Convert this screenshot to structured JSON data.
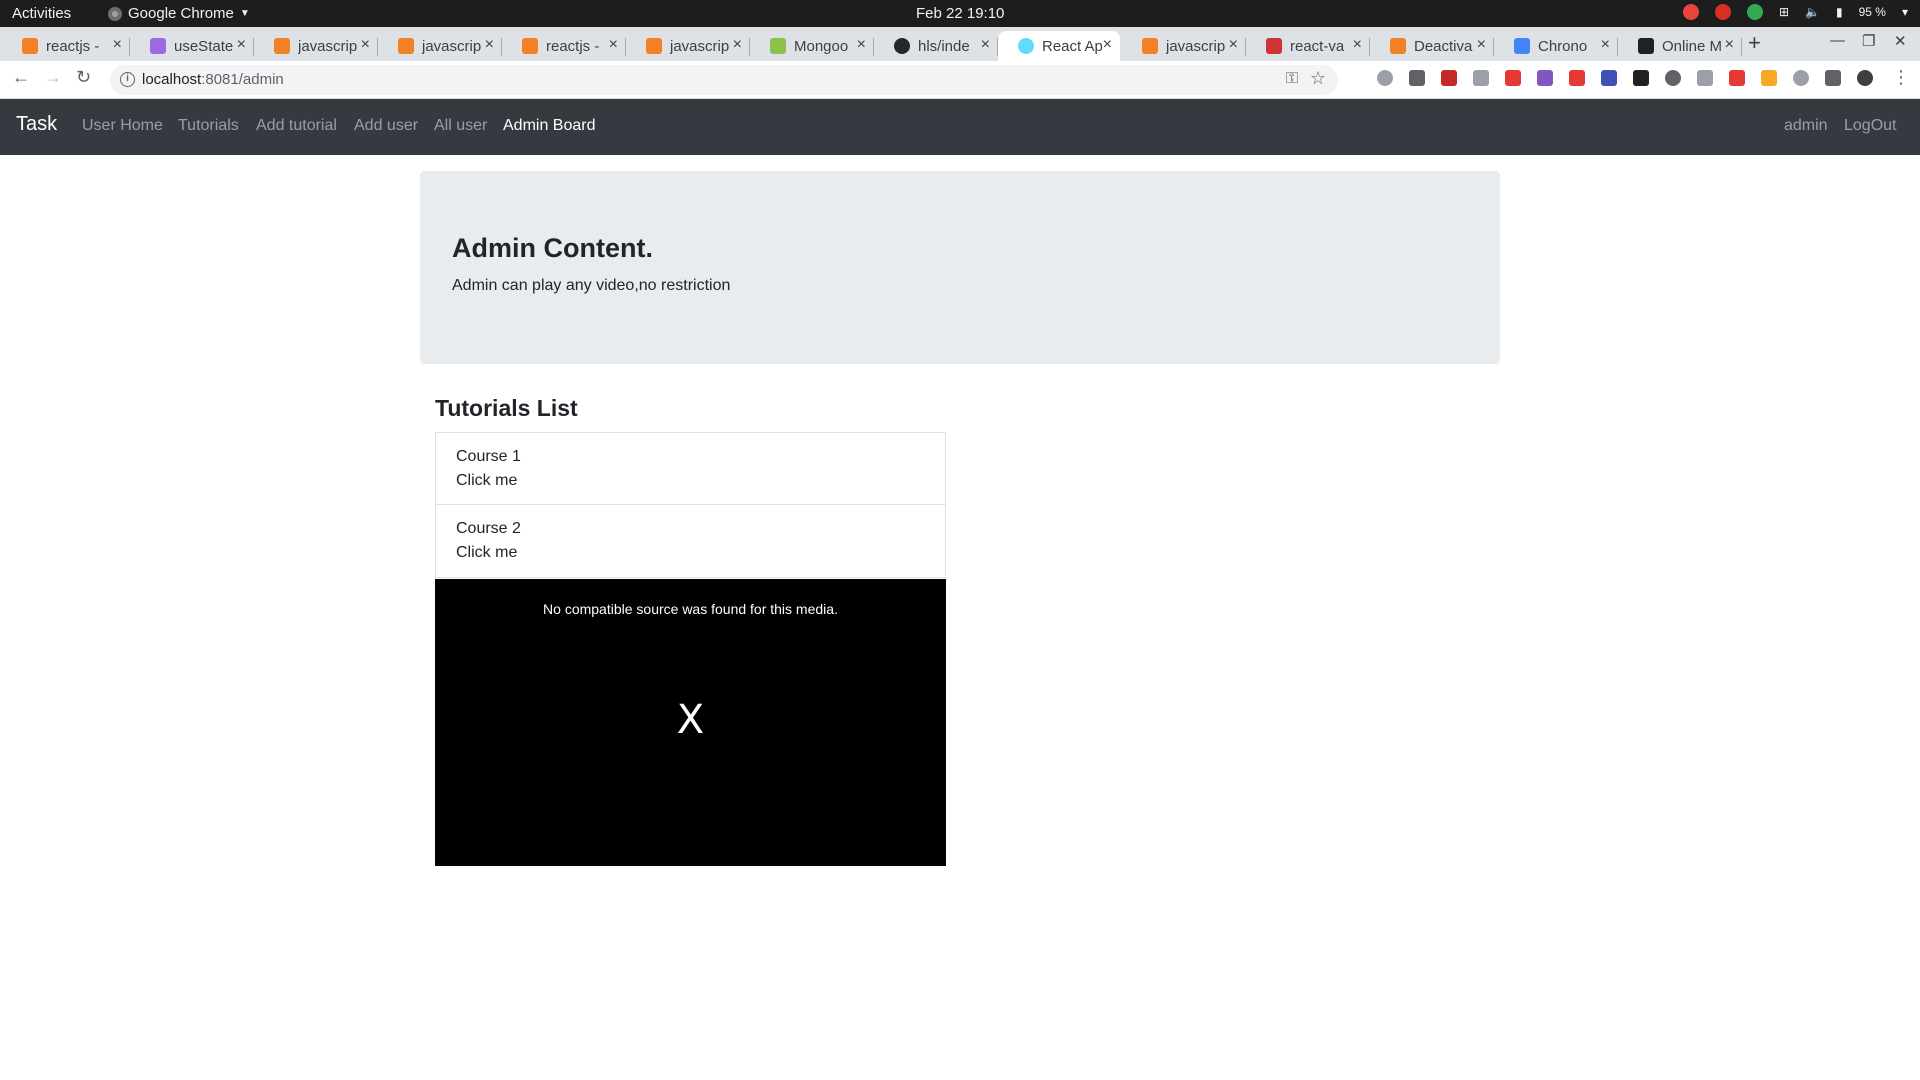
{
  "os": {
    "activities": "Activities",
    "app_name": "Google Chrome",
    "clock": "Feb 22  19:10",
    "battery": "95 %"
  },
  "tabs": [
    {
      "title": "reactjs - ",
      "favicon_color": "#f48024"
    },
    {
      "title": "useState",
      "favicon_color": "#9c6ade"
    },
    {
      "title": "javascrip",
      "favicon_color": "#f48024"
    },
    {
      "title": "javascrip",
      "favicon_color": "#f48024"
    },
    {
      "title": "reactjs - ",
      "favicon_color": "#f48024"
    },
    {
      "title": "javascrip",
      "favicon_color": "#f48024"
    },
    {
      "title": "Mongoo",
      "favicon_color": "#8bc34a"
    },
    {
      "title": "hls/inde",
      "favicon_color": "#24292e"
    },
    {
      "title": "React Ap",
      "favicon_color": "#61dafb"
    },
    {
      "title": "javascrip",
      "favicon_color": "#f48024"
    },
    {
      "title": "react-va",
      "favicon_color": "#cc3534"
    },
    {
      "title": "Deactiva",
      "favicon_color": "#f48024"
    },
    {
      "title": "Chrono",
      "favicon_color": "#4285f4"
    },
    {
      "title": "Online M",
      "favicon_color": "#202124"
    }
  ],
  "browser": {
    "url_host": "localhost",
    "url_path": ":8081/admin"
  },
  "navbar": {
    "brand": "Task",
    "links": [
      "User Home",
      "Tutorials",
      "Add tutorial",
      "Add user",
      "All user",
      "Admin Board"
    ],
    "user": "admin",
    "logout": "LogOut"
  },
  "jumbotron": {
    "title": "Admin Content.",
    "text": "Admin can play any video,no restriction"
  },
  "tutorials": {
    "title": "Tutorials List",
    "items": [
      {
        "name": "Course 1",
        "action": "Click me"
      },
      {
        "name": "Course 2",
        "action": "Click me"
      }
    ]
  },
  "player": {
    "message": "No compatible source was found for this media.",
    "close": "X"
  }
}
